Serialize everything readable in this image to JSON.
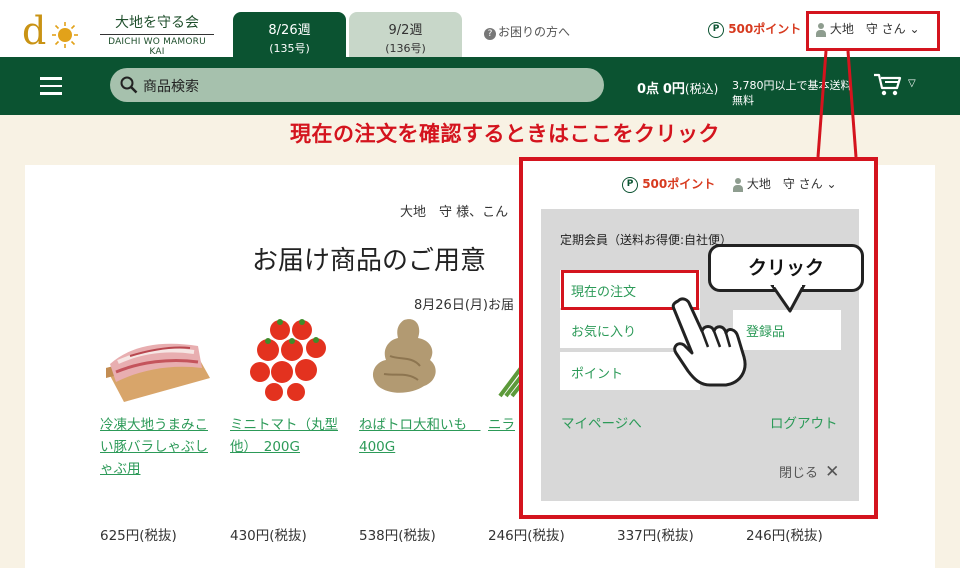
{
  "header": {
    "logo_mark": "d",
    "logo_jp": "大地を守る会",
    "logo_en": "DAICHI WO MAMORU KAI",
    "weeks": [
      {
        "date": "8/26週",
        "issue": "(135号)"
      },
      {
        "date": "9/2週",
        "issue": "(136号)"
      }
    ],
    "help_label": "お困りの方へ",
    "points_label": "500ポイント",
    "user_label": "大地　守 さん"
  },
  "nav": {
    "search_placeholder": "商品検索",
    "cart_count": "0点",
    "cart_amount": "0円",
    "cart_tax": "(税込)",
    "shipping_note": "3,780円以上で基本送料無料"
  },
  "callout_text": "現在の注文を確認するときはここをクリック",
  "main": {
    "greeting": "大地　守 様、こん",
    "headline": "お届け商品のご用意",
    "date_line": "8月26日(月)お届",
    "products": [
      {
        "name": "冷凍大地うまみこい豚バラしゃぶしゃぶ用",
        "price": "625円(税抜)"
      },
      {
        "name": "ミニトマト（丸型他）　200G",
        "price": "430円(税抜)"
      },
      {
        "name": "ねばトロ大和いも　400G",
        "price": "538円(税抜)"
      },
      {
        "name": "ニラ",
        "price": "246円(税抜)"
      },
      {
        "name": "",
        "price": "337円(税抜)"
      },
      {
        "name": "",
        "price": "246円(税抜)"
      }
    ]
  },
  "dropdown": {
    "points_label": "500ポイント",
    "user_label": "大地　守 さん",
    "member_type": "定期会員（送料お得便:自社便）",
    "items": [
      "現在の注文",
      "お気に入り",
      "ポイント"
    ],
    "registered_label": "登録品",
    "mypage_label": "マイページへ",
    "logout_label": "ログアウト",
    "close_label": "閉じる"
  },
  "bubble_text": "クリック",
  "colors": {
    "brand_green": "#0b5331",
    "accent_red": "#d4141e",
    "link_green": "#2c9a58",
    "points_red": "#d73a1f"
  }
}
